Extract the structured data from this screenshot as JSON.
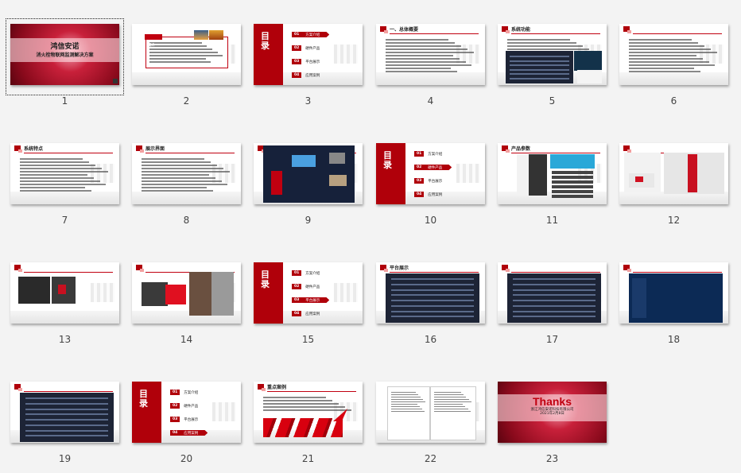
{
  "view": "slide-sorter",
  "selected_slide": 1,
  "colors": {
    "accent_red": "#b0000a",
    "background": "#f3f3f3",
    "dark_screen": "#1d2436"
  },
  "agenda": {
    "title": "目录",
    "items": [
      {
        "no": "01",
        "label": "方案介绍"
      },
      {
        "no": "02",
        "label": "硬件产品"
      },
      {
        "no": "03",
        "label": "平台展示"
      },
      {
        "no": "04",
        "label": "应用案例"
      }
    ]
  },
  "slides": [
    {
      "number": "1",
      "type": "cover",
      "title": "鸿信安诺",
      "subtitle": "消火栓物联网监测解决方案"
    },
    {
      "number": "2",
      "type": "intro",
      "title": "简介"
    },
    {
      "number": "3",
      "type": "agenda",
      "active": 0
    },
    {
      "number": "4",
      "type": "text",
      "title": "一、总体概要"
    },
    {
      "number": "5",
      "type": "screens",
      "title": "系统功能"
    },
    {
      "number": "6",
      "type": "text",
      "title": ""
    },
    {
      "number": "7",
      "type": "text",
      "title": "系统特点"
    },
    {
      "number": "8",
      "type": "text",
      "title": "展示界面"
    },
    {
      "number": "9",
      "type": "diagram",
      "title": ""
    },
    {
      "number": "10",
      "type": "agenda",
      "active": 1
    },
    {
      "number": "11",
      "type": "product",
      "title": "产品参数"
    },
    {
      "number": "12",
      "type": "product2",
      "title": ""
    },
    {
      "number": "13",
      "type": "photos",
      "title": ""
    },
    {
      "number": "14",
      "type": "photos2",
      "title": ""
    },
    {
      "number": "15",
      "type": "agenda",
      "active": 2
    },
    {
      "number": "16",
      "type": "platform",
      "title": "平台展示"
    },
    {
      "number": "17",
      "type": "platform",
      "title": ""
    },
    {
      "number": "18",
      "type": "map",
      "title": ""
    },
    {
      "number": "19",
      "type": "platform",
      "title": ""
    },
    {
      "number": "20",
      "type": "agenda",
      "active": 3
    },
    {
      "number": "21",
      "type": "case",
      "title": "重点案例"
    },
    {
      "number": "22",
      "type": "document",
      "title": ""
    },
    {
      "number": "23",
      "type": "thanks",
      "title": "Thanks",
      "company": "浙江鸿信安诺科技有限公司",
      "date": "2021年2月8日"
    }
  ]
}
